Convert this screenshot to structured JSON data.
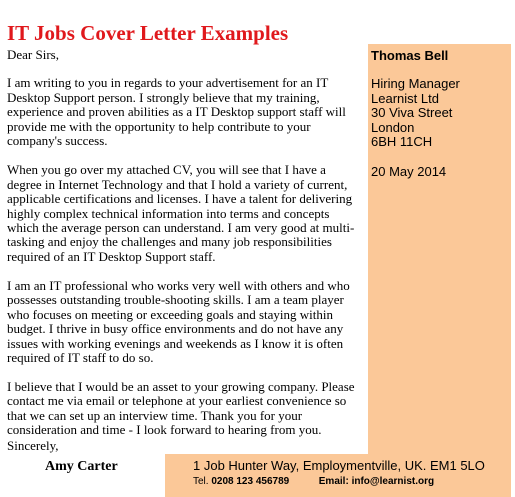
{
  "title": "IT Jobs Cover Letter Examples",
  "salutation": "Dear Sirs,",
  "paragraphs": [
    "I am writing to you in regards to your advertisement for an IT Desktop Support person. I strongly believe that my training, experience and proven abilities as a IT Desktop support staff will provide me with the opportunity to help contribute to your company's success.",
    "When you go over my attached CV, you will see that I have a degree in Internet Technology and that I hold a variety of current, applicable certifications and licenses. I have a talent for delivering highly complex technical information into terms and concepts which the average person can understand. I am very good at multi-tasking and enjoy the challenges and many job responsibilities required of an IT Desktop Support staff.",
    "I am an IT professional who works very well with others and who possesses outstanding trouble-shooting skills. I am a team player who focuses on meeting or exceeding goals and staying within budget. I thrive in busy office environments and do not have any issues with working evenings and weekends as I know it is often required of IT staff to do so.",
    "I believe that I would be an asset to your growing company. Please contact me via email or telephone at your earliest convenience so that we can set up an interview time. Thank you for your consideration and time - I look forward to hearing from you."
  ],
  "closing": "Sincerely,",
  "signature_name": "Amy Carter",
  "sidebar": {
    "sender_name": "Thomas Bell",
    "recipient": [
      "Hiring Manager",
      "Learnist Ltd",
      "30 Viva Street",
      "London",
      "6BH 11CH"
    ],
    "date": "20 May 2014"
  },
  "footer": {
    "address": "1 Job Hunter Way, Employmentville, UK. EM1 5LO",
    "tel_label": "Tel.",
    "tel_value": "0208 123 456789",
    "email_label": "Email:",
    "email_value": "info@learnist.org"
  },
  "colors": {
    "title": "#e0181c",
    "panel": "#fbc898"
  }
}
